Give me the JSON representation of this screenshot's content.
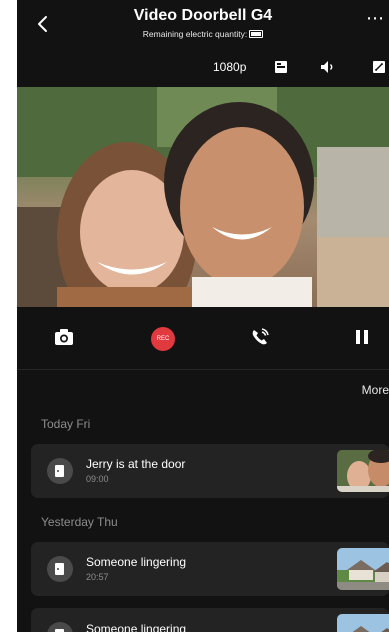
{
  "header": {
    "title": "Video Doorbell G4",
    "subtitle": "Remaining electric quantity:"
  },
  "stream": {
    "resolution": "1080p"
  },
  "controls": {
    "rec_label": "REC"
  },
  "events_section": {
    "more_label": "More"
  },
  "days": [
    {
      "label": "Today Fri",
      "events": [
        {
          "title": "Jerry is at the door",
          "time": "09:00"
        }
      ]
    },
    {
      "label": "Yesterday Thu",
      "events": [
        {
          "title": "Someone lingering",
          "time": "20:57"
        },
        {
          "title": "Someone lingering",
          "time": ""
        }
      ]
    }
  ],
  "colors": {
    "background": "#121212",
    "card": "#232323",
    "rec": "#e0393e",
    "muted_text": "#8c8c8c"
  }
}
